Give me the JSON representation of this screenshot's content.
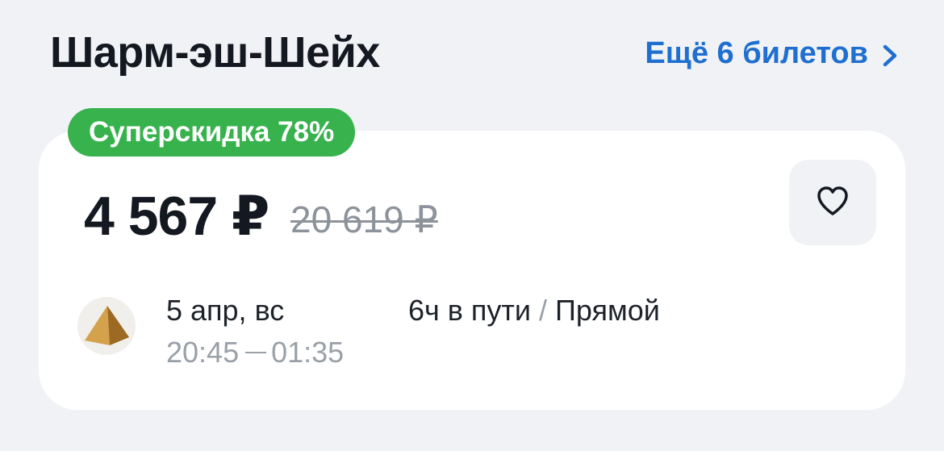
{
  "header": {
    "title": "Шарм-эш-Шейх",
    "more_link_label": "Ещё 6 билетов"
  },
  "offer": {
    "badge": "Суперскидка 78%",
    "price": "4 567 ₽",
    "old_price": "20 619 ₽",
    "date": "5 апр, вс",
    "depart_time": "20:45",
    "arrive_time": "01:35",
    "duration": "6ч в пути",
    "separator": "/",
    "stops": "Прямой",
    "airline_logo": "pyramid-logo"
  },
  "colors": {
    "accent": "#1f6fd0",
    "badge": "#37b24d",
    "background": "#f0f2f5"
  },
  "icons": {
    "more": "chevron-right-icon",
    "favorite": "heart-icon"
  }
}
